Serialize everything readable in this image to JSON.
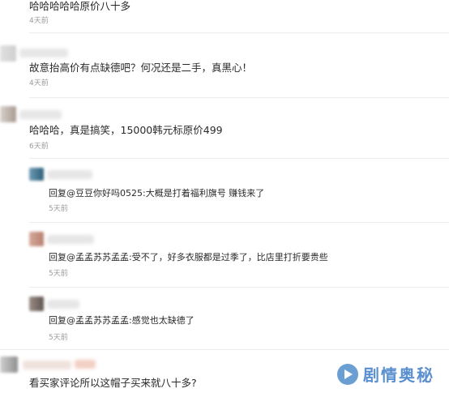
{
  "comments": [
    {
      "text": "哈哈哈哈哈原价八十多",
      "time": "4天前"
    },
    {
      "text": "故意抬高价有点缺德吧？何况还是二手，真黑心！",
      "time": "4天前"
    },
    {
      "text": "哈哈哈，真是搞笑，15000韩元标原价499",
      "time": "6天前"
    }
  ],
  "replies": [
    {
      "text": "回复@豆豆你好吗0525:大概是打着福利旗号 赚钱来了",
      "time": "5天前"
    },
    {
      "text": "回复@孟孟苏苏孟孟:受不了，好多衣服都是过季了，比店里打折要贵些",
      "time": "5天前"
    },
    {
      "text": "回复@孟孟苏苏孟孟:感觉也太缺德了",
      "time": "5天前"
    }
  ],
  "last_comment": {
    "text": "看买家评论所以这帽子买来就八十多?"
  },
  "watermark": {
    "text": "剧情奥秘",
    "icon": "play-logo-icon",
    "color": "#5a8fd0"
  }
}
